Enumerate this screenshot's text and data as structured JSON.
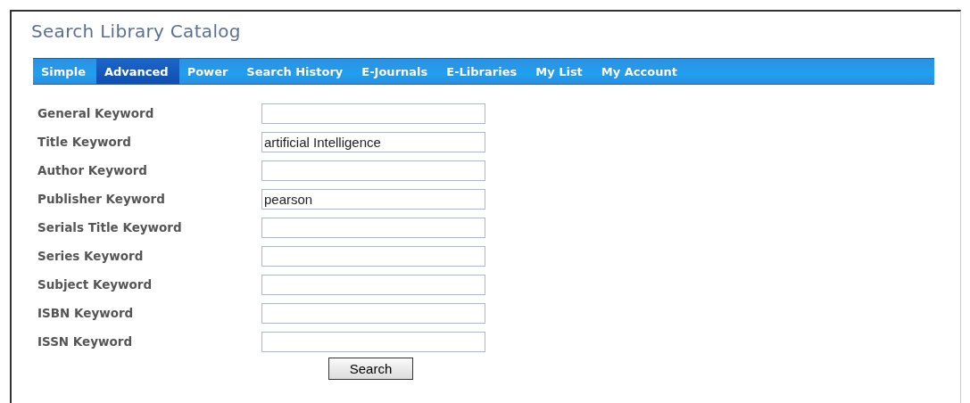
{
  "title": "Search Library Catalog",
  "tabs": [
    {
      "label": "Simple",
      "selected": false
    },
    {
      "label": "Advanced",
      "selected": true
    },
    {
      "label": "Power",
      "selected": false
    },
    {
      "label": "Search History",
      "selected": false
    },
    {
      "label": "E-Journals",
      "selected": false
    },
    {
      "label": "E-Libraries",
      "selected": false
    },
    {
      "label": "My List",
      "selected": false
    },
    {
      "label": "My Account",
      "selected": false
    }
  ],
  "fields": [
    {
      "label": "General Keyword"
    },
    {
      "label": "Title Keyword",
      "value": "artificial Intelligence"
    },
    {
      "label": "Author Keyword"
    },
    {
      "label": "Publisher Keyword",
      "value": "pearson"
    },
    {
      "label": "Serials Title Keyword"
    },
    {
      "label": "Series Keyword"
    },
    {
      "label": "Subject Keyword"
    },
    {
      "label": "ISBN Keyword"
    },
    {
      "label": "ISSN Keyword"
    }
  ],
  "search_button": "Search"
}
